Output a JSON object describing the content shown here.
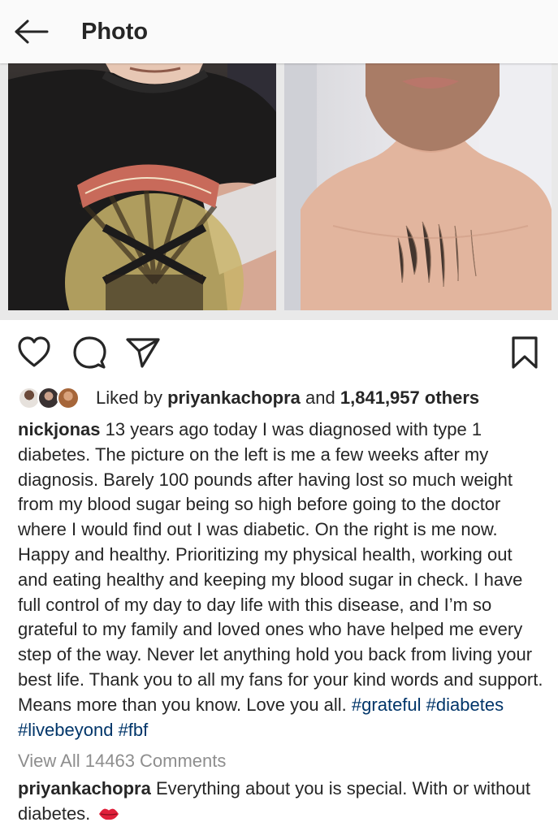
{
  "header": {
    "title": "Photo",
    "back_icon": "arrow-left-icon"
  },
  "post": {
    "images": [
      {
        "description_icon": "photo-left-image"
      },
      {
        "description_icon": "photo-right-image"
      }
    ],
    "actions": {
      "like_icon": "heart-icon",
      "comment_icon": "comment-bubble-icon",
      "share_icon": "paper-plane-icon",
      "save_icon": "bookmark-icon"
    },
    "likes": {
      "prefix": "Liked by",
      "user": "priyankachopra",
      "connector": "and",
      "count": "1,841,957 others"
    },
    "caption": {
      "username": "nickjonas",
      "text": "13 years ago today I was diagnosed with type 1 diabetes. The picture on the left is me a few weeks after my diagnosis. Barely 100 pounds after having lost so much weight from my blood sugar being so high before going to the doctor where I would find out I was diabetic. On the right is me now. Happy and healthy. Prioritizing my physical health, working out and eating healthy and keeping my blood sugar in check. I have full control of my day to day life with this disease, and I’m so grateful to my family and loved ones who have helped me every step of the way. Never let anything hold you back from living your best life. Thank you to all my fans for your kind words and support. Means more than you know. Love you all.",
      "hashtags": [
        "#grateful",
        "#diabetes",
        "#livebeyond",
        "#fbf"
      ]
    },
    "view_comments": "View All 14463 Comments",
    "top_comment": {
      "username": "priyankachopra",
      "text": "Everything about you is special. With or without diabetes.",
      "emoji_icon": "lips-kiss-icon"
    }
  },
  "colors": {
    "text": "#262626",
    "muted": "#8e8e8e",
    "hashtag": "#003569",
    "header_bg": "#fafafa"
  }
}
